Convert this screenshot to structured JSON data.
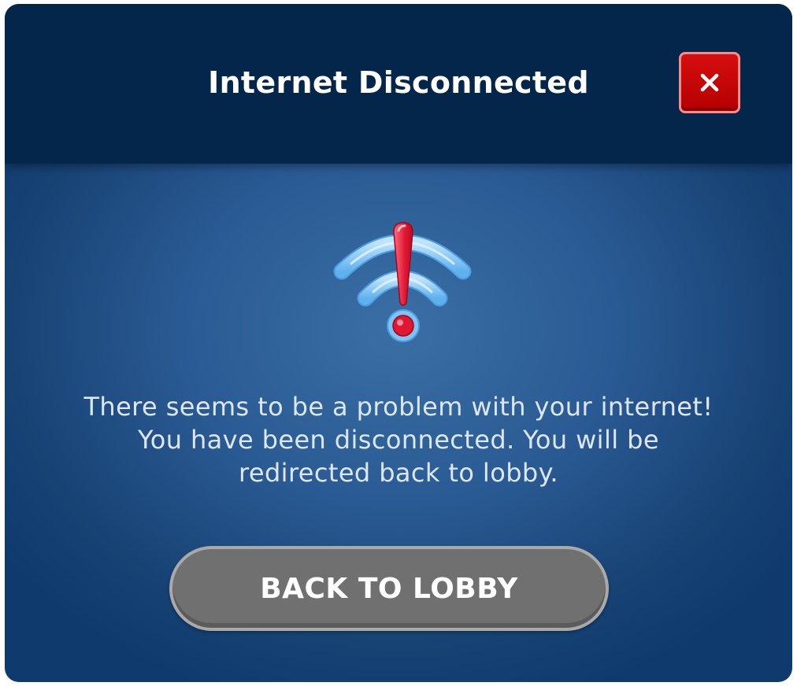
{
  "dialog": {
    "title": "Internet Disconnected",
    "close_icon": "close-x-icon",
    "status_icon": "wifi-disconnected-warning-icon",
    "message_lines": [
      "There seems to be a problem with your internet!",
      "You have been disconnected. You will be",
      "redirected back to lobby."
    ],
    "button_label": "BACK TO LOBBY"
  },
  "colors": {
    "header_bg": "#03264a",
    "body_bg": "#2a5a93",
    "close_button": "#c90808",
    "close_border": "#ff8a8a",
    "button_bg": "#707070",
    "button_border": "#a9a9a9",
    "wifi": "#7fc4f5",
    "alert": "#e0223a"
  }
}
